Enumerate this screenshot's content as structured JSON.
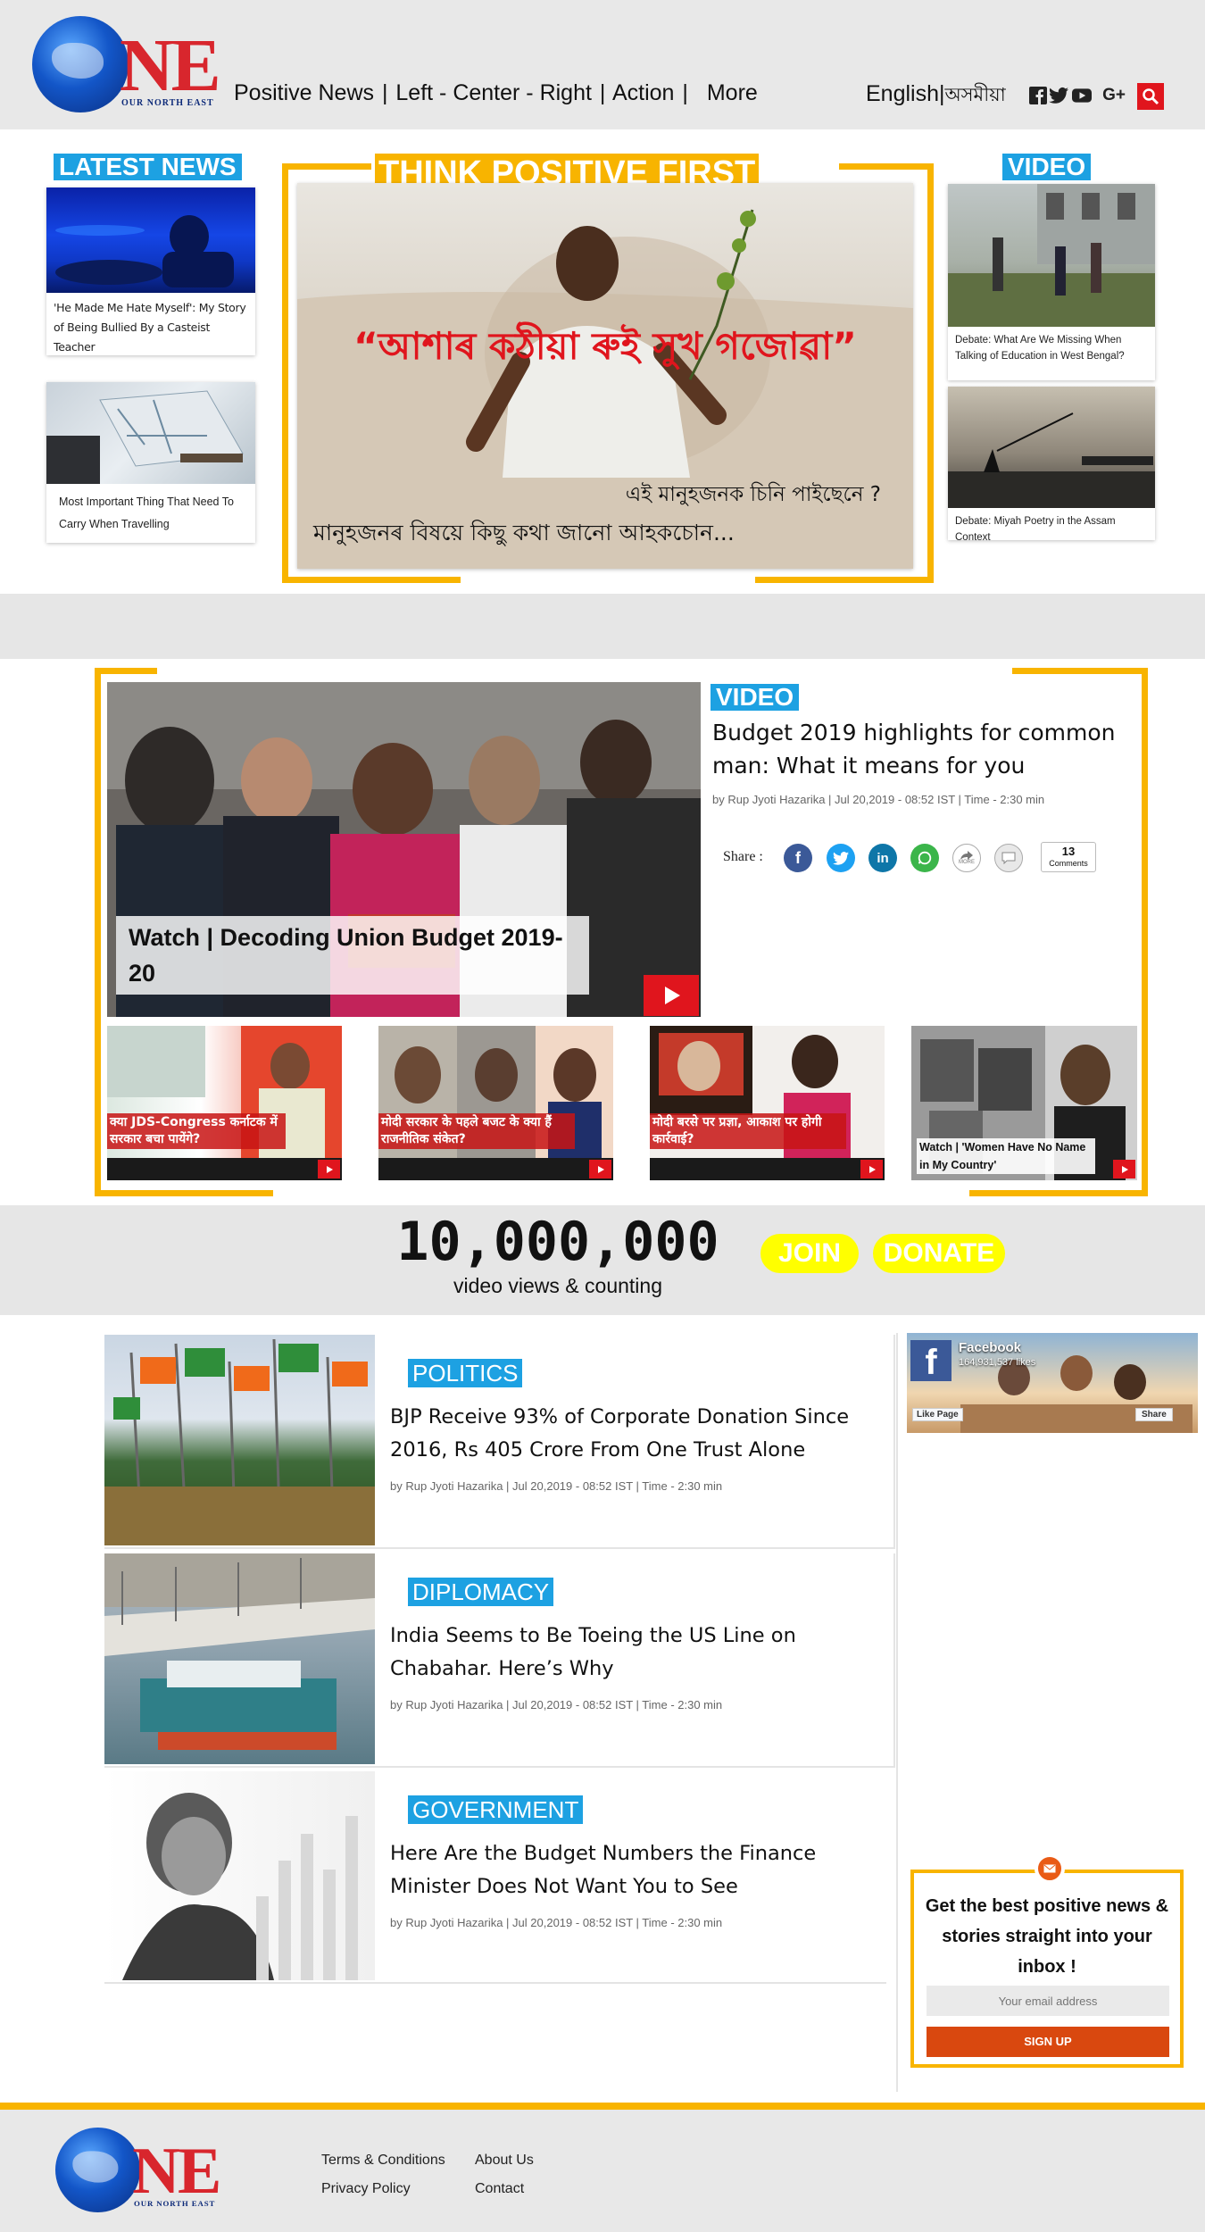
{
  "header": {
    "logo_text": "NE",
    "logo_tagline": "OUR NORTH EAST",
    "nav": [
      "Positive News",
      "|",
      "Left - Center - Right",
      "|",
      "Action",
      "|",
      "More"
    ],
    "lang_en": "English",
    "lang_sep": "|",
    "lang_as": "অসমীয়া",
    "social_icons": [
      "facebook-icon",
      "twitter-icon",
      "youtube-icon",
      "google-plus-icon"
    ],
    "search_icon": "search-icon"
  },
  "latest": {
    "label": "LATEST NEWS",
    "items": [
      {
        "title": "'He Made Me Hate Myself': My Story of Being Bullied By a Casteist Teacher"
      },
      {
        "title": "Most Important Thing That Need To Carry When Travelling"
      }
    ]
  },
  "hero": {
    "label": "THINK POSITIVE FIRST",
    "quote": "“আশাৰ কঠীয়া ৰুই সুখ গজোৱা”",
    "line2": "এই মানুহজনক চিনি পাইছেনে ?",
    "line3": "মানুহজনৰ বিষয়ে কিছু কথা জানো আহকচোন..."
  },
  "video_side": {
    "label": "VIDEO",
    "items": [
      {
        "title": "Debate: What Are We Missing When Talking of Education in West Bengal?"
      },
      {
        "title": "Debate: Miyah Poetry in the Assam Context"
      }
    ]
  },
  "feature": {
    "label": "VIDEO",
    "title": "Budget 2019 highlights for common man: What it means for you",
    "meta": "by Rup Jyoti Hazarika | Jul 20,2019 - 08:52 IST | Time - 2:30 min",
    "share_label": "Share :",
    "share_icons": [
      "facebook-icon",
      "twitter-icon",
      "linkedin-icon",
      "whatsapp-icon",
      "more-share-icon",
      "comment-icon"
    ],
    "share_more": "MORE",
    "comments_count": "13",
    "comments_label": "Comments",
    "video_caption": "Watch | Decoding Union Budget 2019-20",
    "thumbs": [
      {
        "caption": "क्या JDS-Congress कर्नाटक में सरकार बचा पायेंगे?"
      },
      {
        "caption": "मोदी सरकार के पहले बजट के क्या हैं राजनीतिक संकेत?"
      },
      {
        "caption": "मोदी बरसे पर प्रज्ञा, आकाश पर होगी कार्रवाई?"
      },
      {
        "caption": "Watch | 'Women Have No Name in My Country'"
      }
    ]
  },
  "counter": {
    "value": "10,000,000",
    "caption": "video views & counting",
    "join": "JOIN",
    "donate": "DONATE"
  },
  "articles": [
    {
      "category": "POLITICS",
      "title": "BJP Receive 93% of Corporate Donation Since 2016, Rs 405 Crore From One Trust Alone",
      "meta": "by Rup Jyoti Hazarika | Jul 20,2019 - 08:52 IST | Time - 2:30 min"
    },
    {
      "category": "DIPLOMACY",
      "title": "India Seems to Be Toeing the US Line on Chabahar. Here’s Why",
      "meta": "by Rup Jyoti Hazarika | Jul 20,2019 - 08:52 IST | Time - 2:30 min"
    },
    {
      "category": "GOVERNMENT",
      "title": "Here Are the Budget Numbers the Finance Minister Does Not Want You to See",
      "meta": "by Rup Jyoti Hazarika | Jul 20,2019 - 08:52 IST | Time - 2:30 min"
    }
  ],
  "fb_widget": {
    "name": "Facebook",
    "likes": "164,931,537 likes",
    "like_page": "Like Page",
    "share": "Share"
  },
  "newsletter": {
    "icon": "mail-icon",
    "heading": "Get the best positive news & stories straight into your inbox !",
    "placeholder": "Your email address",
    "button": "SIGN UP"
  },
  "footer": {
    "links": [
      "Terms & Conditions",
      "About Us",
      "Privacy Policy",
      "Contact"
    ]
  },
  "colors": {
    "accent_blue": "#1da1e2",
    "accent_yellow": "#f8b400",
    "red": "#e0151d",
    "signup": "#d9480f"
  }
}
